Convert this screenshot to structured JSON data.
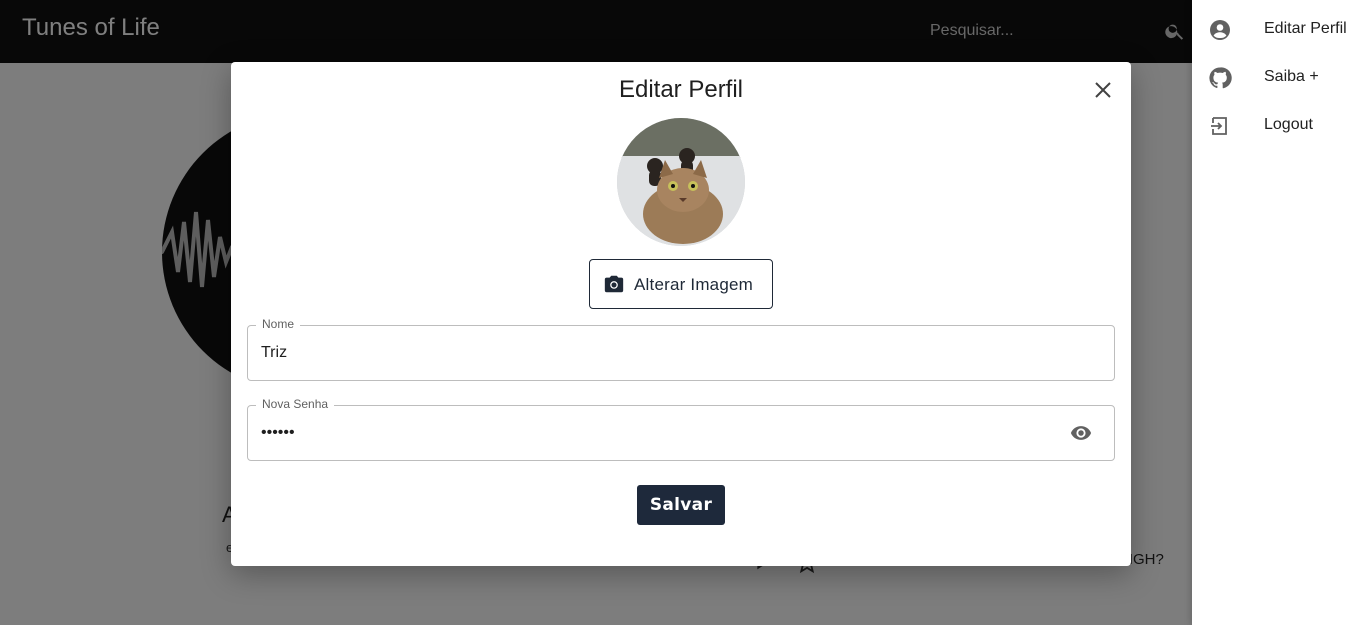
{
  "app": {
    "brand": "Tunes of Life",
    "search": {
      "placeholder": "Pesquisar...",
      "value": ""
    },
    "background": {
      "title": "A",
      "subtitle": "e",
      "track_text": "HIGH?"
    }
  },
  "drawer": {
    "items": [
      {
        "label": "Editar Perfil",
        "icon": "account-circle-icon"
      },
      {
        "label": "Saiba +",
        "icon": "github-icon"
      },
      {
        "label": "Logout",
        "icon": "logout-icon"
      }
    ]
  },
  "modal": {
    "title": "Editar Perfil",
    "change_image_label": "Alterar Imagem",
    "fields": {
      "name": {
        "label": "Nome",
        "value": "Triz"
      },
      "password": {
        "label": "Nova Senha",
        "value": "••••••"
      }
    },
    "save_label": "Salvar"
  },
  "colors": {
    "topbar": "#111111",
    "primary_button": "#1e293b",
    "overlay": "rgba(0,0,0,0.5)"
  }
}
